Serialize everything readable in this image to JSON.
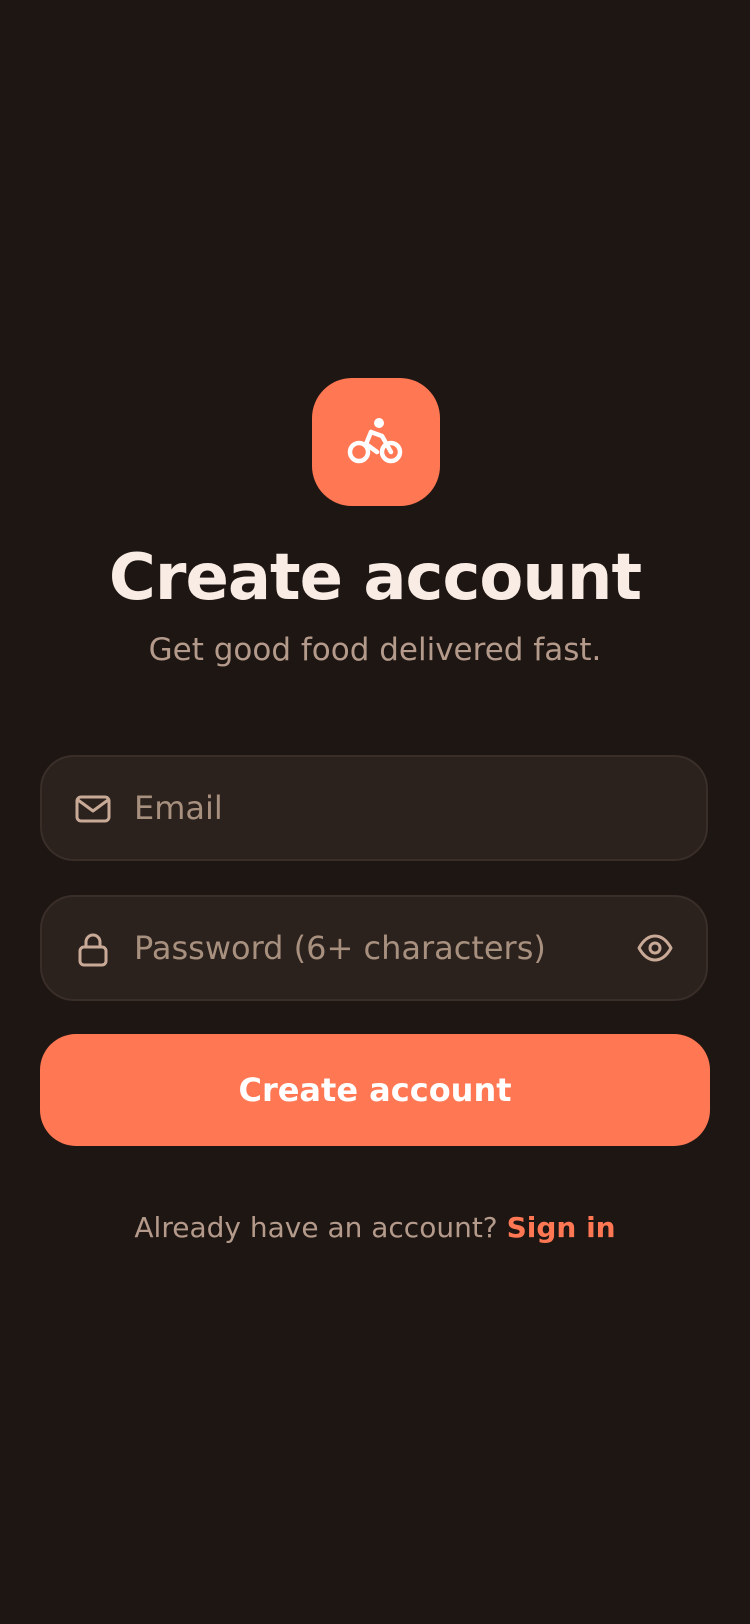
{
  "app": {
    "logo_icon": "bicycle-rider-icon",
    "accent_color": "#ff7753",
    "background_color": "#1e1613"
  },
  "header": {
    "title": "Create account",
    "subtitle": "Get good food delivered fast."
  },
  "form": {
    "email": {
      "placeholder": "Email",
      "value": "",
      "icon": "mail-icon"
    },
    "password": {
      "placeholder": "Password (6+ characters)",
      "value": "",
      "icon": "lock-icon",
      "toggle_icon": "eye-icon"
    },
    "submit_label": "Create account"
  },
  "footer": {
    "prompt": "Already have an account?",
    "link_label": "Sign in"
  }
}
